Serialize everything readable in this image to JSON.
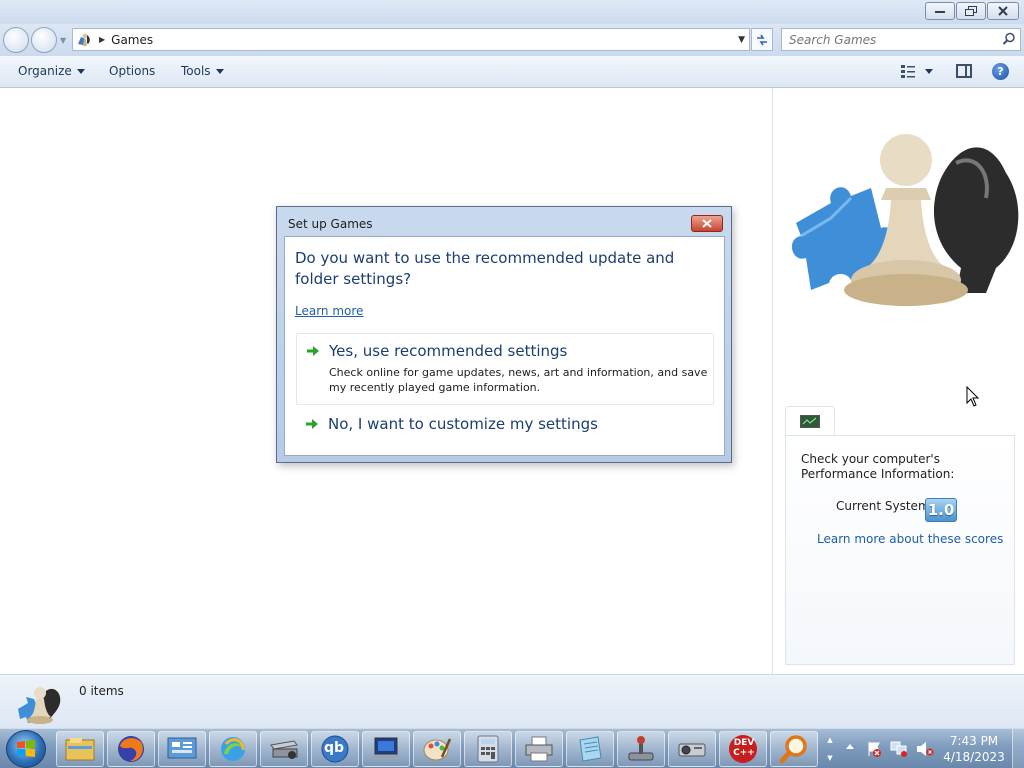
{
  "window": {
    "address": {
      "location": "Games"
    },
    "search": {
      "placeholder": "Search Games"
    },
    "commands": {
      "organize": "Organize",
      "options": "Options",
      "tools": "Tools"
    },
    "help_label": "?"
  },
  "dialog": {
    "title": "Set up Games",
    "question": "Do you want to use the recommended update and folder settings?",
    "learn_more": "Learn more",
    "option_yes": {
      "title": "Yes, use recommended settings",
      "description": "Check online for game updates, news, art and information, and save my recently played game information."
    },
    "option_no": {
      "title": "No, I want to customize my settings"
    }
  },
  "performance": {
    "heading": "Check your computer's Performance Information:",
    "label": "Current System",
    "score": "1.0",
    "link": "Learn more about these scores"
  },
  "details": {
    "count": "0 items"
  },
  "taskbar": {
    "apps": [
      {
        "name": "file-explorer-icon"
      },
      {
        "name": "firefox-icon"
      },
      {
        "name": "control-panel-icon"
      },
      {
        "name": "browser-icon"
      },
      {
        "name": "scanner-icon"
      },
      {
        "name": "qbittorrent-icon",
        "label": "qb"
      },
      {
        "name": "remote-desktop-icon"
      },
      {
        "name": "paint-icon"
      },
      {
        "name": "calculator-icon"
      },
      {
        "name": "printer-icon"
      },
      {
        "name": "notepad-icon"
      },
      {
        "name": "joystick-icon"
      },
      {
        "name": "projector-icon"
      },
      {
        "name": "dev-cpp-icon",
        "label": "DEV C++"
      },
      {
        "name": "magnifier-icon"
      }
    ],
    "clock": {
      "time": "7:43 PM",
      "date": "4/18/2023"
    }
  },
  "colors": {
    "accent": "#1a3e74",
    "link": "#1f5ea8",
    "close_red": "#c7452e",
    "arrow_green": "#2aa12a"
  }
}
